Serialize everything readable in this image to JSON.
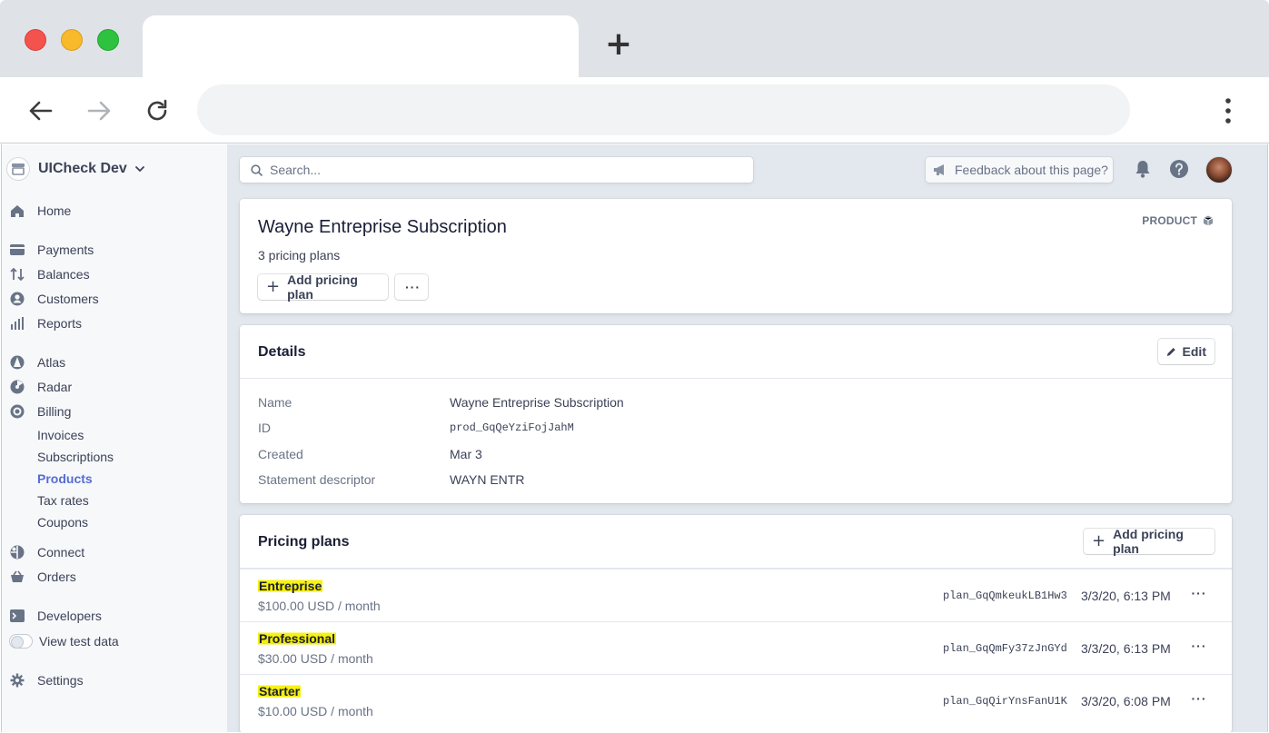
{
  "browser": {
    "new_tab_glyph": "+",
    "url": ""
  },
  "account": {
    "name": "UICheck Dev"
  },
  "sidebar": {
    "items": [
      {
        "label": "Home",
        "icon": "home-icon"
      },
      {
        "label": "Payments",
        "icon": "payments-icon"
      },
      {
        "label": "Balances",
        "icon": "balances-icon"
      },
      {
        "label": "Customers",
        "icon": "customers-icon"
      },
      {
        "label": "Reports",
        "icon": "reports-icon"
      },
      {
        "label": "Atlas",
        "icon": "atlas-icon"
      },
      {
        "label": "Radar",
        "icon": "radar-icon"
      },
      {
        "label": "Billing",
        "icon": "billing-icon"
      },
      {
        "label": "Connect",
        "icon": "connect-icon"
      },
      {
        "label": "Orders",
        "icon": "orders-icon"
      },
      {
        "label": "Developers",
        "icon": "terminal-icon"
      },
      {
        "label": "View test data",
        "icon": "toggle"
      },
      {
        "label": "Settings",
        "icon": "gear-icon"
      }
    ],
    "billing_sub": [
      {
        "label": "Invoices"
      },
      {
        "label": "Subscriptions"
      },
      {
        "label": "Products",
        "active": true
      },
      {
        "label": "Tax rates"
      },
      {
        "label": "Coupons"
      }
    ],
    "active_color": "#556cd6"
  },
  "topbar": {
    "search_placeholder": "Search...",
    "feedback_label": "Feedback about this page?"
  },
  "product": {
    "title": "Wayne Entreprise Subscription",
    "subtitle": "3 pricing plans",
    "tag": "PRODUCT",
    "add_plan_label": "Add pricing plan",
    "more_label": "···"
  },
  "details": {
    "title": "Details",
    "edit_label": "Edit",
    "rows": [
      {
        "key": "Name",
        "value": "Wayne Entreprise Subscription"
      },
      {
        "key": "ID",
        "value": "prod_GqQeYziFojJahM"
      },
      {
        "key": "Created",
        "value": "Mar 3"
      },
      {
        "key": "Statement descriptor",
        "value": "WAYN ENTR"
      }
    ]
  },
  "pricing": {
    "title": "Pricing plans",
    "add_plan_label": "Add pricing plan",
    "plans": [
      {
        "name": "Entreprise",
        "price": "$100.00 USD / month",
        "id": "plan_GqQmkeukLB1Hw3",
        "date": "3/3/20, 6:13 PM",
        "more": "···"
      },
      {
        "name": "Professional",
        "price": "$30.00 USD / month",
        "id": "plan_GqQmFy37zJnGYd",
        "date": "3/3/20, 6:13 PM",
        "more": "···"
      },
      {
        "name": "Starter",
        "price": "$10.00 USD / month",
        "id": "plan_GqQirYnsFanU1K",
        "date": "3/3/20, 6:08 PM",
        "more": "···"
      }
    ],
    "highlight_color": "#f4ec00"
  }
}
